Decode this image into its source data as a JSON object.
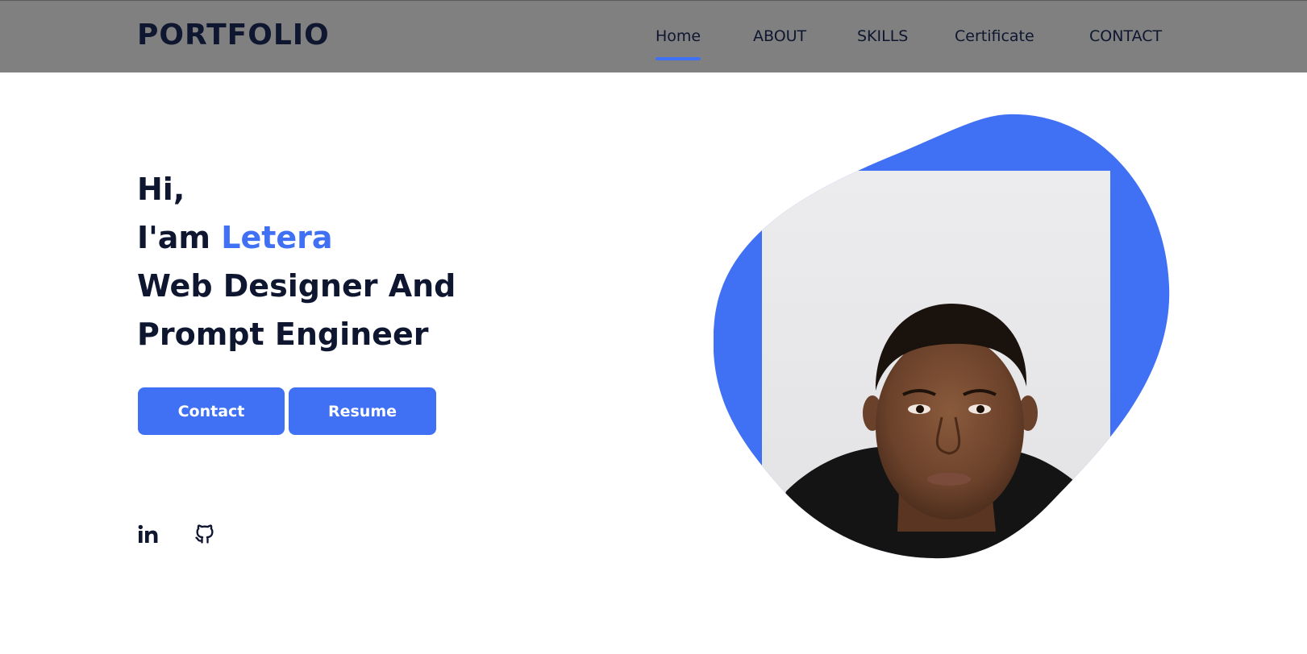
{
  "header": {
    "logo": "PORTFOLIO",
    "nav": [
      {
        "label": "Home",
        "active": true
      },
      {
        "label": "ABOUT"
      },
      {
        "label": "SKILLS"
      },
      {
        "label": "Certificate"
      },
      {
        "label": "CONTACT"
      }
    ]
  },
  "hero": {
    "greeting": "Hi,",
    "intro_prefix": "I'am",
    "name": "Letera",
    "role_line1": "Web Designer And",
    "role_line2": "Prompt Engineer",
    "buttons": {
      "contact": "Contact",
      "resume": "Resume"
    }
  },
  "social": [
    {
      "icon": "linkedin-icon"
    },
    {
      "icon": "github-icon"
    }
  ],
  "colors": {
    "accent": "#4070f4",
    "text_dark": "#0e1630",
    "header_bg": "#808080"
  }
}
